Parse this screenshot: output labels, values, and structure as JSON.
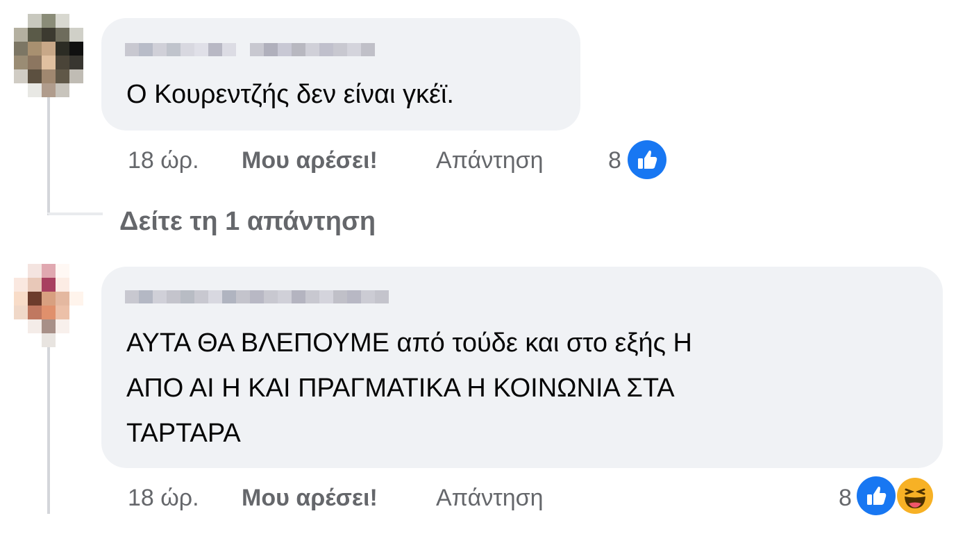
{
  "comments": [
    {
      "text": "Ο Κουρεντζής δεν είναι γκέϊ.",
      "time": "18 ώρ.",
      "like_label": "Μου αρέσει!",
      "reply_label": "Απάντηση",
      "reaction_count": "8",
      "reactions": [
        "like-icon"
      ]
    },
    {
      "text_lines": [
        "ΑΥΤΑ ΘΑ ΒΛΕΠΟΥΜΕ από τούδε και στο εξής Η",
        "ΑΠΟ ΑΙ Η ΚΑΙ ΠΡΑΓΜΑΤΙΚΑ Η ΚΟΙΝΩΝΙΑ ΣΤΑ",
        "ΤΑΡΤΑΡΑ"
      ],
      "time": "18 ώρ.",
      "like_label": "Μου αρέσει!",
      "reply_label": "Απάντηση",
      "reaction_count": "8",
      "reactions": [
        "like-icon",
        "haha-icon"
      ]
    }
  ],
  "view_replies_label": "Δείτε τη 1 απάντηση",
  "colors": {
    "bubble": "#f0f2f5",
    "meta_text": "#65676b",
    "like_blue": "#1877f2",
    "haha_yellow": "#f7b125"
  }
}
